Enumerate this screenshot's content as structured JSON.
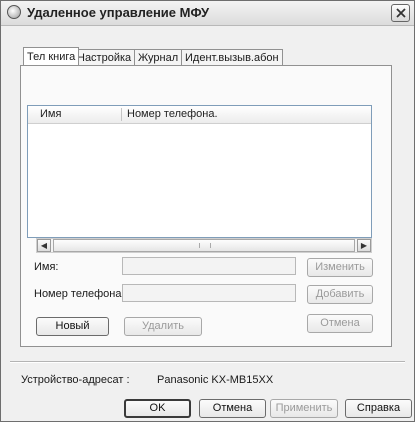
{
  "window": {
    "title": "Удаленное управление МФУ"
  },
  "tabs": [
    {
      "label": "Тел книга",
      "active": true
    },
    {
      "label": "Настройка",
      "active": false
    },
    {
      "label": "Журнал",
      "active": false
    },
    {
      "label": "Идент.вызыв.абон",
      "active": false
    }
  ],
  "list": {
    "columns": [
      "Имя",
      "Номер телефона."
    ],
    "rows": []
  },
  "form": {
    "name_label": "Имя:",
    "name_value": "",
    "phone_label": "Номер телефона.:",
    "phone_value": ""
  },
  "buttons": {
    "change": "Изменить",
    "add": "Добавить",
    "new": "Новый",
    "delete": "Удалить",
    "cancel_inner": "Отмена",
    "ok": "OK",
    "cancel": "Отмена",
    "apply": "Применить",
    "help": "Справка"
  },
  "device": {
    "label": "Устройство-адресат :",
    "value": "Panasonic KX-MB15XX"
  },
  "icons": {
    "app": "remote-control-icon",
    "close": "close-icon",
    "scroll_left": "arrow-left-icon",
    "scroll_right": "arrow-right-icon"
  }
}
